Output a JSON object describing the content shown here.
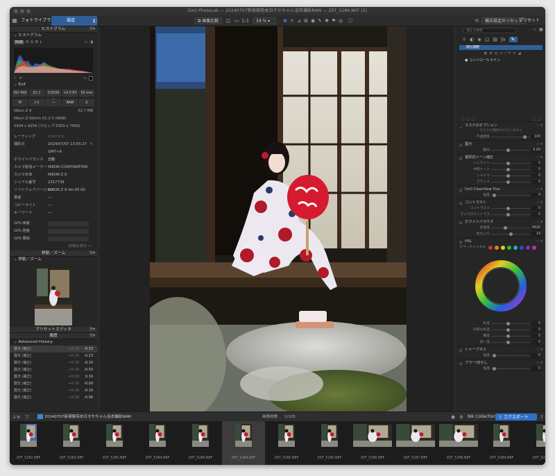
{
  "window": {
    "title": "DxO PhotoLab — 20240707新宿御苑本日すかちゃん浴衣撮影RAW — Z9T_5284.NEF (2)"
  },
  "toolbar": {
    "tab_library": "フォトライブラリ",
    "tab_customize": "設定",
    "compare_label": "画像比較",
    "zoom": "34 %",
    "preset_button": "補正設定のリセット",
    "preset_label": "プリセット"
  },
  "left_panel": {
    "histogram_title": "ヒストグラム",
    "histogram_sub": "ヒストグラム",
    "channels": [
      "RGB",
      "R",
      "G",
      "B",
      "L"
    ],
    "exif_title": "Exif",
    "exif_row1": [
      "ISO 400",
      "ƒ/1.2",
      "1/3200 s",
      "+0.0 EV",
      "50 mm"
    ],
    "exif_row2": [
      "M",
      "[•]",
      "—",
      "RAW",
      "♀"
    ],
    "camera": "Nikon Z 9",
    "filesize": "52.7 MB",
    "lens": "Nikon Z 50mm f/1.2 S (RAW)",
    "dims": "5504 x 8256 (クロップ 5303 x 7958)",
    "meta": [
      {
        "k": "レーティング",
        "v": "☆☆☆☆☆"
      },
      {
        "k": "撮影日",
        "v": "2024/07/07 13:55:27"
      },
      {
        "k": "",
        "v": "GMT+9"
      },
      {
        "k": "ホワイトバランス",
        "v": "自動"
      },
      {
        "k": "カメラ製造メーカー",
        "v": "NIKON CORPORATION"
      },
      {
        "k": "カメラ本体",
        "v": "NIKON Z 9"
      },
      {
        "k": "シリアル番号",
        "v": "2317739"
      },
      {
        "k": "ソフトウェアバージョン",
        "v": "NIKON Z 9 Ver.05.00"
      },
      {
        "k": "著者",
        "v": "—"
      },
      {
        "k": "コピーライト",
        "v": "—"
      },
      {
        "k": "キーワード",
        "v": "—"
      }
    ],
    "gps": [
      "GPS 緯度",
      "GPS 経度",
      "GPS 標高"
    ],
    "detail_link": "詳細を表示",
    "nav_title": "移動／ズーム",
    "nav_sub": "移動／ズーム",
    "preset_editor": "プリセットエディタ",
    "history_title": "履歴",
    "history_sub": "Advanced History",
    "history": [
      {
        "n": "露光 (補正)",
        "a": "+0.18",
        "b": "-0.33"
      },
      {
        "n": "露光 (補正)",
        "a": "+0.18",
        "b": "-0.23"
      },
      {
        "n": "露光 (補正)",
        "a": "+0.18",
        "b": "-0.10"
      },
      {
        "n": "露光 (補正)",
        "a": "+0.18",
        "b": "-0.03"
      },
      {
        "n": "露光 (補正)",
        "a": "+0.18",
        "b": "0.10"
      },
      {
        "n": "露光 (補正)",
        "a": "+0.18",
        "b": "-0.00"
      },
      {
        "n": "露光 (補正)",
        "a": "+0.18",
        "b": "-0.10"
      },
      {
        "n": "露光 (補正)",
        "a": "+0.18",
        "b": "-0.06"
      }
    ]
  },
  "right_panel": {
    "search_placeholder": "補正を検索",
    "local_adj": "部分調整",
    "control_line": "コントロールライン",
    "mask_options": "マスクのオプション",
    "mask_note": "マスクが選択されていません",
    "opacity_label": "不透明度",
    "opacity_value": "100",
    "exposure": {
      "title": "露光",
      "label": "露光",
      "value": "0.00"
    },
    "tone": {
      "title": "選択的トーン補正",
      "rows": [
        {
          "l": "ハイライト",
          "v": "0"
        },
        {
          "l": "中間トーン",
          "v": "0"
        },
        {
          "l": "シャドウ",
          "v": "0"
        },
        {
          "l": "ブラック",
          "v": "0"
        }
      ]
    },
    "clearview": {
      "title": "DxO ClearView Plus",
      "label": "強度",
      "value": "0"
    },
    "contrast": {
      "title": "コントラスト",
      "rows": [
        {
          "l": "コントラスト",
          "v": "0"
        },
        {
          "l": "マイクロコントラスト",
          "v": "0"
        }
      ]
    },
    "wb": {
      "title": "ホワイトバランス",
      "rows": [
        {
          "l": "色温度",
          "v": "4828"
        },
        {
          "l": "色かぶり",
          "v": "14"
        }
      ]
    },
    "hsl": {
      "title": "HSL",
      "channel_label": "カラーチャンネル",
      "colors": [
        "#d23030",
        "#e08020",
        "#e0d020",
        "#40b040",
        "#20b0b0",
        "#2050d0",
        "#8030c0",
        "#c030a0"
      ]
    },
    "hsl_sliders": [
      {
        "l": "彩度",
        "v": "0"
      },
      {
        "l": "均等な彩度",
        "v": "0"
      },
      {
        "l": "輝度",
        "v": "0"
      },
      {
        "l": "混一度",
        "v": "0"
      }
    ],
    "sharpness": {
      "title": "シャープネス",
      "label": "強度",
      "value": "0"
    },
    "blur": {
      "title": "ブラー/ぼかし",
      "label": "強度",
      "value": "0"
    }
  },
  "filmstrip": {
    "folder": "20240707新宿御苑本日すかちゃん浴衣撮影RAW",
    "count_label": "画像枚数",
    "count": "1/105",
    "nik_label": "Nik Collection",
    "export_label": "エクスポート",
    "items": [
      "Z9T_5282.NEF",
      "Z9T_5283.NEF",
      "Z9T_5283.NEF",
      "Z9T_5284.NEF",
      "Z9T_5284.NEF",
      "Z9T_5284.NEF",
      "Z9T_5285.NEF",
      "Z9T_5285.NEF",
      "Z9T_5286.NEF",
      "Z9T_5287.NEF",
      "Z9T_5288.NEF",
      "Z9T_5289.NEF",
      "Z9T_5290.NEF"
    ],
    "selected_index": 5,
    "rating": "☆☆☆☆☆"
  }
}
